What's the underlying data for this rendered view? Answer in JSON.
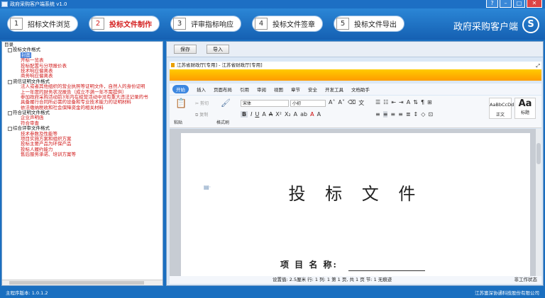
{
  "app": {
    "title": "政府采购客户端系统 v1.0",
    "brand": "政府采购客户端",
    "logo_letter": "S"
  },
  "steps": [
    {
      "num": "1",
      "label": "招标文件浏览"
    },
    {
      "num": "2",
      "label": "投标文件制作",
      "active": true
    },
    {
      "num": "3",
      "label": "评审指标响应"
    },
    {
      "num": "4",
      "label": "投标文件签章"
    },
    {
      "num": "5",
      "label": "投标文件导出"
    }
  ],
  "tree": {
    "root": "目录",
    "sections": [
      {
        "label": "投标文件格式",
        "items": [
          "封面",
          "开标一览表",
          "投标配置与分项报价表",
          "技术响应偏离表",
          "商务响应偏离表"
        ],
        "selected": 0
      },
      {
        "label": "资信证明文件格式",
        "items": [
          "法人或者其他组织的营业执照等证明文件，自然人的身份证明",
          "上一年度的财务状况报告（成立不满一年不需提供）",
          "参加政府采购活动前3年内在经营活动中没有重大违法记录的书",
          "具备履行合同所必需的设备和专业技术能力的证明材料",
          "依法缴纳税收和社会保障资金的相关材料"
        ]
      },
      {
        "label": "符合证明文件格式",
        "items": [
          "企业声明函",
          "符合审查"
        ]
      },
      {
        "label": "综合评审文件格式",
        "items": [
          "技术参数及性能等",
          "项目实施方案和组织方案",
          "投标主要产品为环保产品",
          "投标人履约能力",
          "售后服务承诺、培训方案等"
        ]
      }
    ]
  },
  "toolbar": {
    "save": "保存",
    "import": "导入"
  },
  "doc": {
    "bar_title": "江苏省财政厅[专用] - 江苏省财政厅[专用]",
    "ribbon_tabs": [
      "开始",
      "插入",
      "页面布局",
      "引用",
      "审阅",
      "视图",
      "章节",
      "安全",
      "开发工具",
      "文档助手"
    ],
    "font_name": "宋体",
    "font_size": "小初",
    "paste": "粘贴",
    "cut": "剪切",
    "copy": "复制",
    "format_painter": "格式刷",
    "style_normal_sample": "AaBbCcDd",
    "style_normal": "正文",
    "style_heading_sample": "Aa",
    "style_heading": "标题",
    "title": "投 标 文 件",
    "project_label": "项 目 名 称:",
    "status_info": "设置值: 2.5厘米    行: 1    列: 1    第 1 页, 共 1 页    节: 1    无痕迹",
    "status_right": "非工作状态"
  },
  "footer": {
    "version": "主程序版本: 1.0.1.2",
    "company": "江苏富深协通科技股份有限公司"
  }
}
